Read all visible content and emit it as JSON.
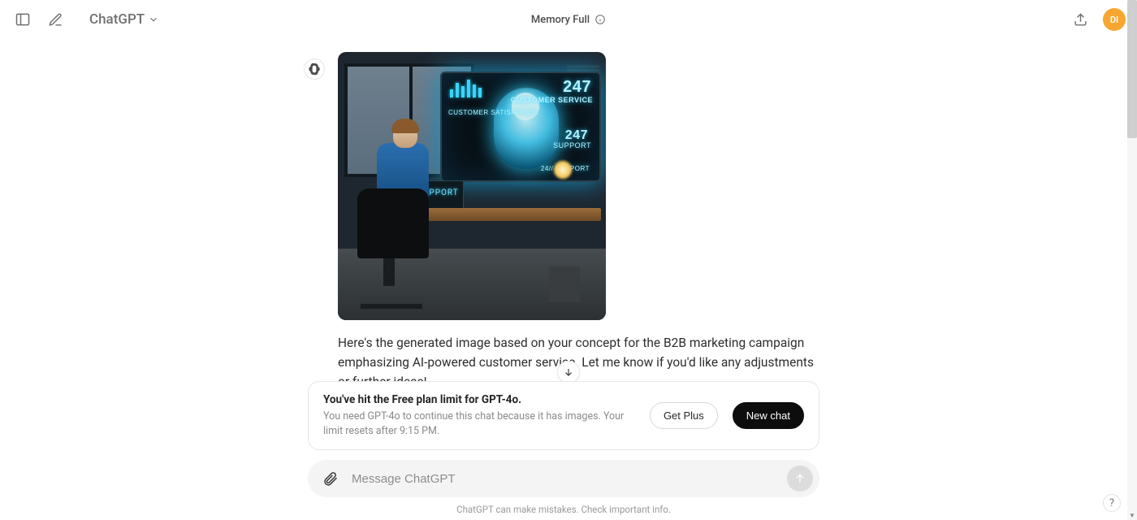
{
  "header": {
    "model_label": "ChatGPT",
    "memory_label": "Memory Full",
    "avatar_initials": "DI"
  },
  "message": {
    "text": "Here's the generated image based on your concept for the B2B marketing campaign emphasizing AI-powered customer service. Let me know if you'd like any adjustments or further ideas!",
    "image": {
      "overlay_247_top": "247",
      "overlay_customer_service": "CUSTOMER SERVICE",
      "overlay_247_mid": "247",
      "overlay_support_mid": "SUPPORT",
      "overlay_247_small": "24// SUPPORT",
      "overlay_customer_sat": "CUSTOMER SATISFATIIDN",
      "overlay_support_laptop": "SUPPORT"
    }
  },
  "banner": {
    "title": "You've hit the Free plan limit for GPT-4o.",
    "subtitle": "You need GPT-4o to continue this chat because it has images. Your limit resets after 9:15 PM.",
    "get_plus": "Get Plus",
    "new_chat": "New chat"
  },
  "composer": {
    "placeholder": "Message ChatGPT"
  },
  "footer": {
    "note": "ChatGPT can make mistakes. Check important info."
  },
  "help": {
    "label": "?"
  }
}
